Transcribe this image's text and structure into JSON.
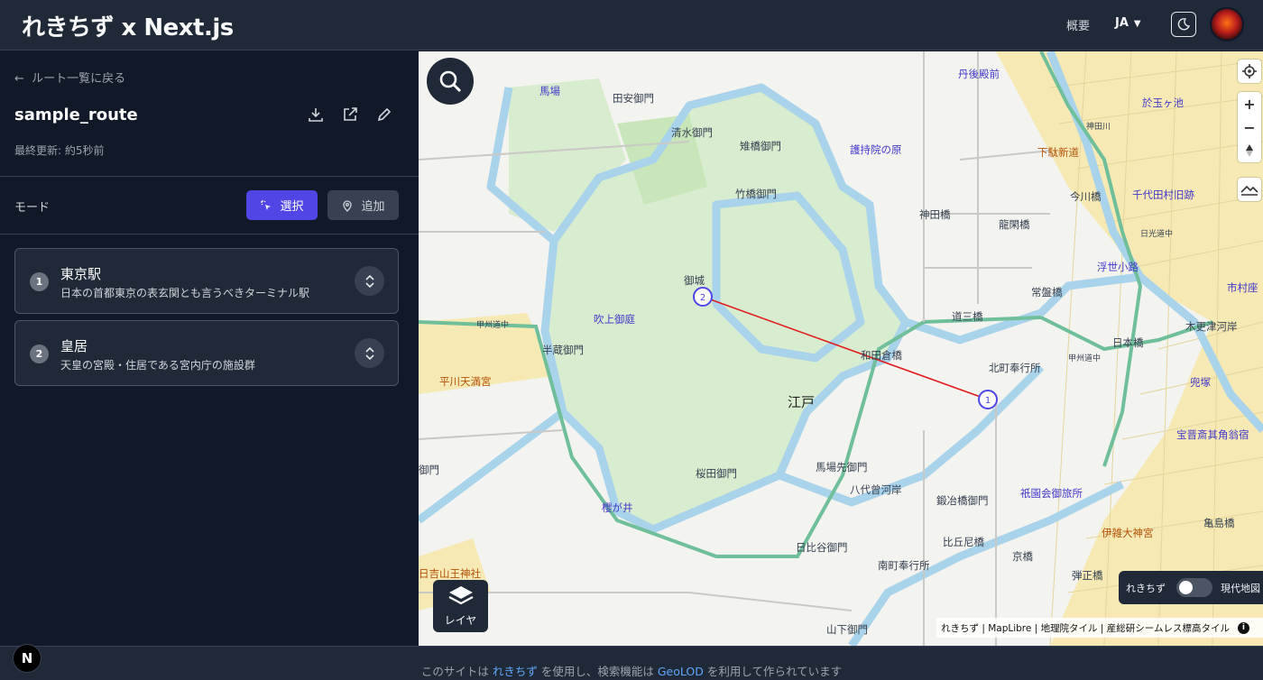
{
  "header": {
    "logo": "れきちず x Next.js",
    "nav_about": "概要",
    "lang": "JA"
  },
  "sidebar": {
    "back_label": "ルート一覧に戻る",
    "route_name": "sample_route",
    "updated": "最終更新: 約5秒前",
    "mode_label": "モード",
    "select_label": "選択",
    "add_label": "追加",
    "points": [
      {
        "index": "1",
        "name": "東京駅",
        "description": "日本の首都東京の表玄関とも言うべきターミナル駅"
      },
      {
        "index": "2",
        "name": "皇居",
        "description": "天皇の宮殿・住居である宮内庁の施設群"
      }
    ]
  },
  "map": {
    "layer_label": "レイヤ",
    "toggle_left": "れきちず",
    "toggle_right": "現代地図",
    "attribution": "れきちず | MapLibre | 地理院タイル | 産総研シームレス標高タイル",
    "markers": [
      "1",
      "2"
    ],
    "labels": {
      "baba": "馬場",
      "tayasu": "田安御門",
      "shimizu": "清水御門",
      "hitotsubashi": "雉橋御門",
      "gojiin": "護持院の原",
      "tango": "丹後殿前",
      "otamagaike": "於玉ヶ池",
      "shimouma": "下駄新道",
      "imagawa": "今川橋",
      "chiyoda": "千代田村旧跡",
      "takebashi": "竹橋御門",
      "kanda": "神田橋",
      "ryukan": "龍閑橋",
      "ukiyo": "浮世小路",
      "shimura": "市村座",
      "tokiwa": "常盤橋",
      "gojo": "御城",
      "fukiage": "吹上御庭",
      "hanzo": "半蔵御門",
      "dosan": "道三橋",
      "kisaratsu": "木更津河岸",
      "nihonbashi": "日本橋",
      "hirakawa": "平川天満宮",
      "wadakura": "和田倉橋",
      "kitamachi": "北町奉行所",
      "kabuto": "兜塚",
      "edo": "江戸",
      "takarai": "宝晋斎其角翁宿",
      "gomon_left": "御門",
      "sakurada": "桜田御門",
      "babasaki": "馬場先御門",
      "yaesu": "八代曾河岸",
      "gion": "祇園会御旅所",
      "sakuragai": "櫻が井",
      "kajibashi": "鍛冶橋御門",
      "iseya": "伊雑大神宮",
      "kamejima": "亀島橋",
      "hibiya": "日比谷御門",
      "hikuni": "比丘尼橋",
      "kyobashi": "京橋",
      "danjo": "弾正橋",
      "hie": "日吉山王神社",
      "minami": "南町奉行所",
      "yamashita": "山下御門",
      "kosyu_road": "甲州道中",
      "kosyu_road2": "甲州道中",
      "nikko_road": "日光道中",
      "kanda_river": "神田川",
      "kosyu_left": "甲州道中"
    }
  },
  "footer": {
    "prefix": "このサイトは",
    "link1": "れきちず",
    "middle": "を使用し、検索機能は",
    "link2": "GeoLOD",
    "suffix": "を利用して作られています"
  }
}
